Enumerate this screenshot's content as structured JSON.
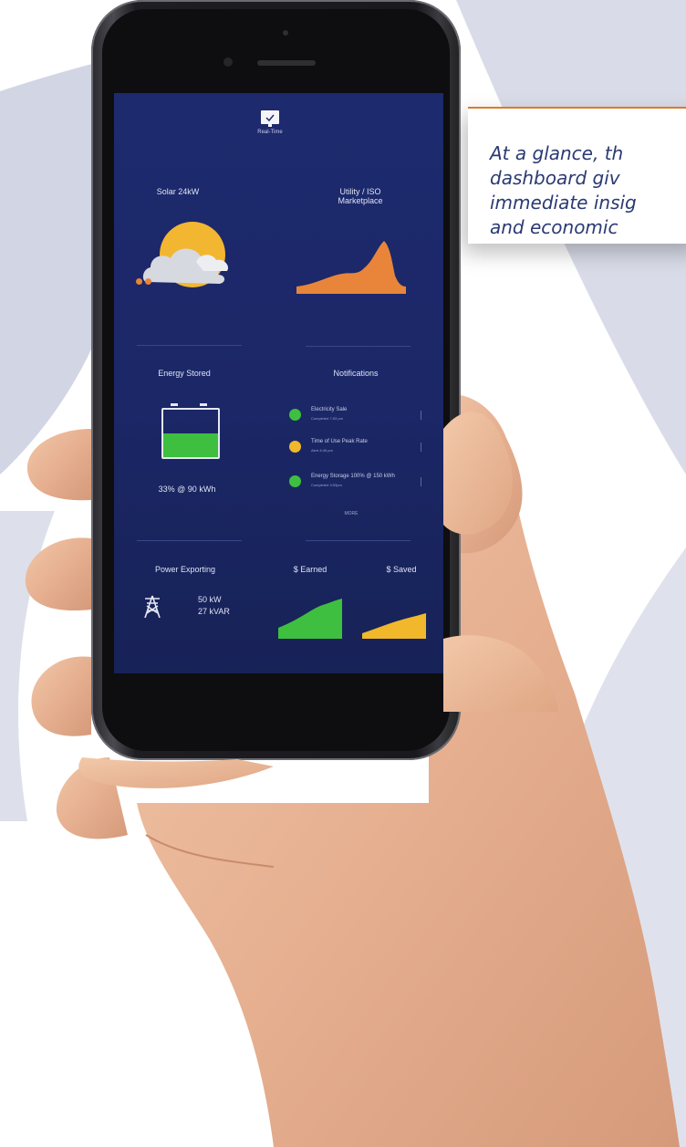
{
  "callout": {
    "text": "At a glance, th\ndashboard giv\nimmediate insig\nand economic"
  },
  "app": {
    "mode_label": "Real-Time",
    "solar": {
      "label": "Solar 24kW"
    },
    "utility": {
      "label": "Utility / ISO\nMarketplace"
    },
    "storage": {
      "title": "Energy Stored",
      "value": "33% @ 90 kWh",
      "fill_fraction": 0.5
    },
    "notifications": {
      "title": "Notifications",
      "items": [
        {
          "title": "Electricity Sale",
          "subtitle": "Completed 7:53 pm",
          "color": "#3fbf3f"
        },
        {
          "title": "Time of Use Peak Rate",
          "subtitle": "Alert 4:45 pm",
          "color": "#f0b82a"
        },
        {
          "title": "Energy Storage 100% @ 150 kWh",
          "subtitle": "Completed 3:53pm",
          "color": "#3fbf3f"
        }
      ],
      "more_label": "MORE"
    },
    "power": {
      "title": "Power Exporting",
      "kw": "50 kW",
      "kvar": "27 kVAR"
    },
    "earned": {
      "label": "$ Earned",
      "color": "#3fbf3f"
    },
    "saved": {
      "label": "$ Saved",
      "color": "#f0b82a"
    },
    "colors": {
      "accent_orange": "#e8853a",
      "background": "#1b2766"
    }
  }
}
